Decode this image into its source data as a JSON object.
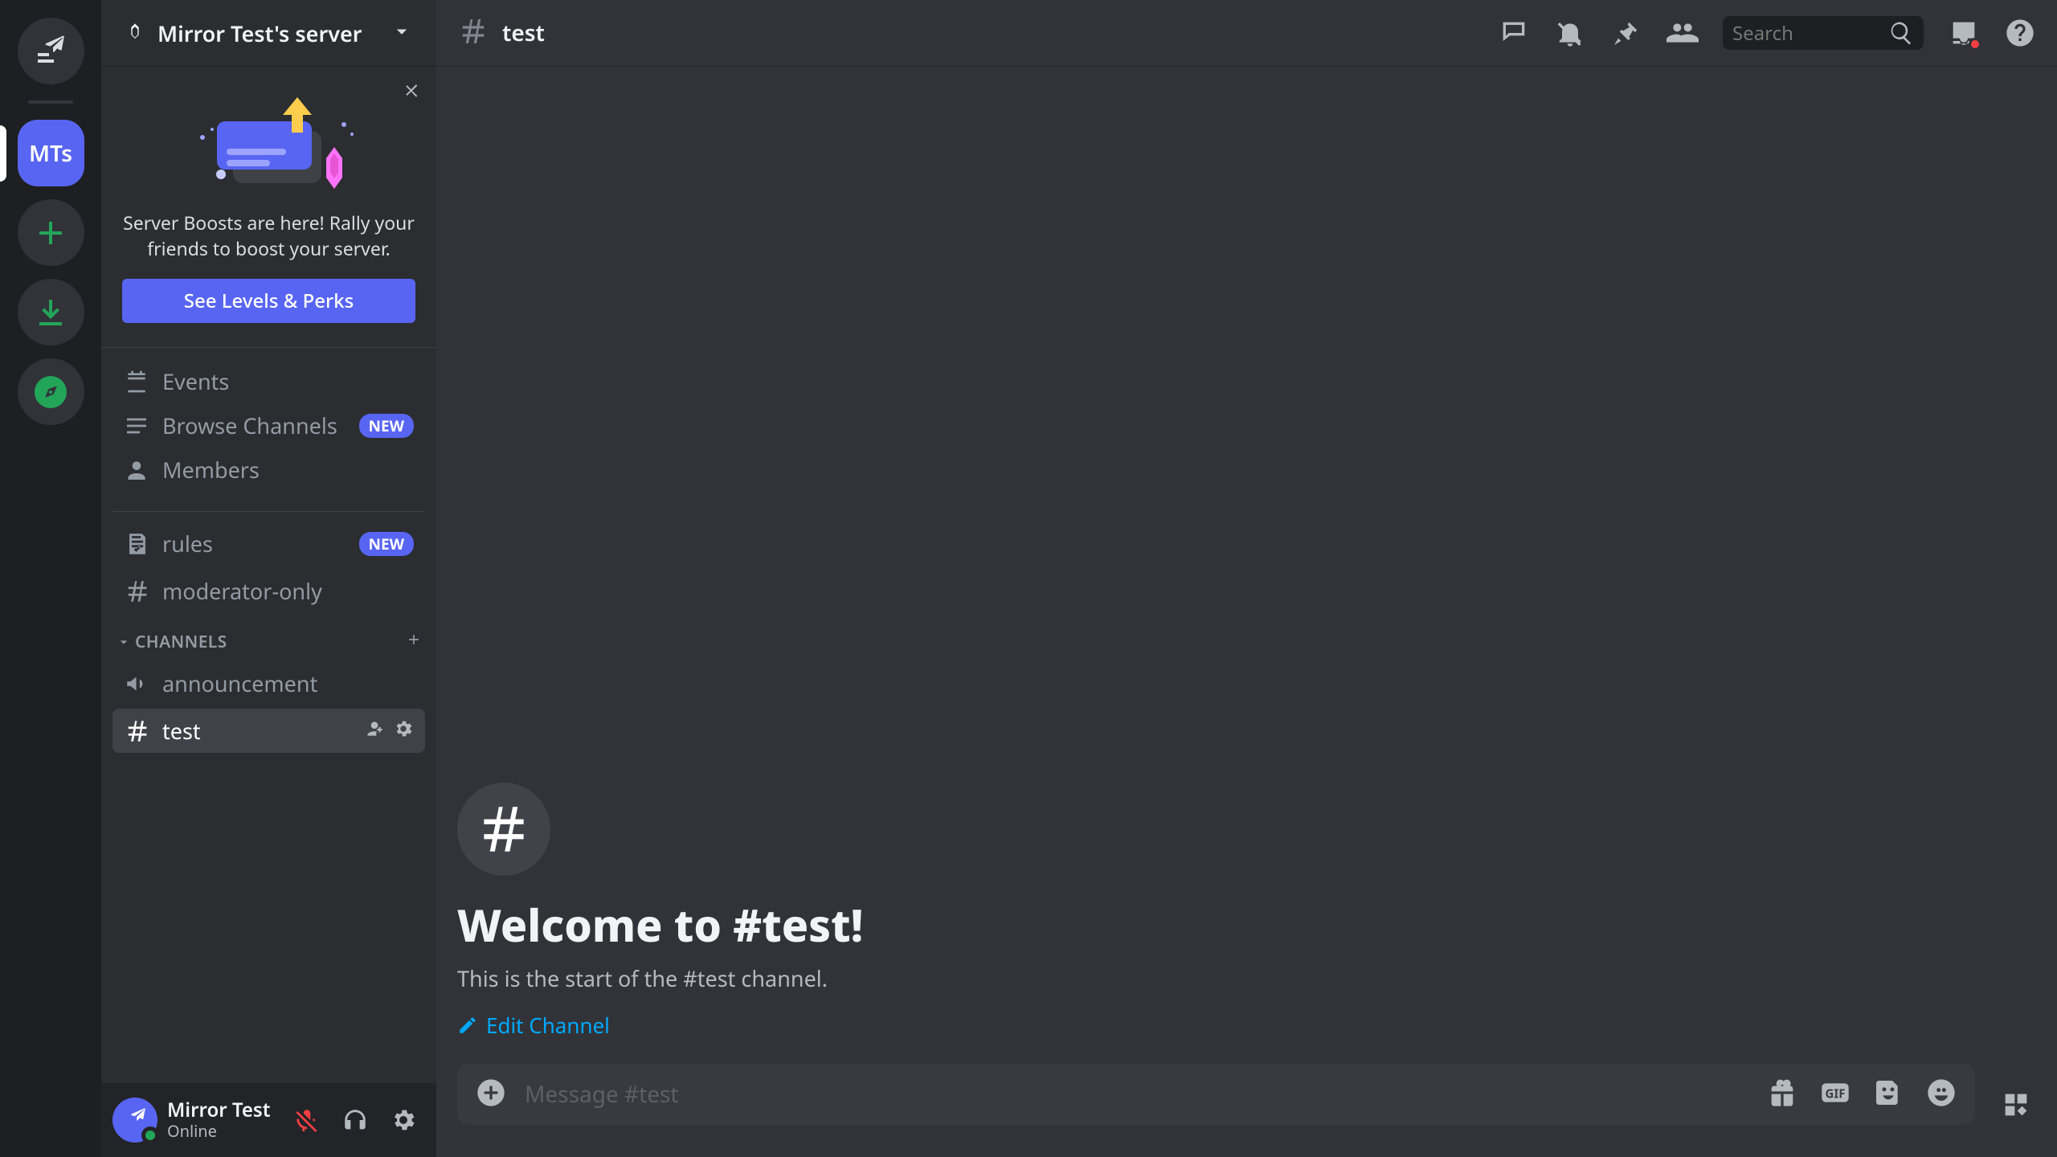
{
  "server": {
    "name": "Mirror Test's server",
    "initials": "MTs"
  },
  "boost": {
    "text": "Server Boosts are here! Rally your friends to boost your server.",
    "button": "See Levels & Perks"
  },
  "sidebar_top": {
    "events": "Events",
    "browse": "Browse Channels",
    "members": "Members",
    "new_badge": "NEW"
  },
  "category": {
    "label": "CHANNELS"
  },
  "channels": {
    "rules": "rules",
    "mod": "moderator-only",
    "announcement": "announcement",
    "test": "test"
  },
  "user": {
    "name": "Mirror Test",
    "status": "Online"
  },
  "header": {
    "channel": "test",
    "search_placeholder": "Search"
  },
  "welcome": {
    "title": "Welcome to #test!",
    "subtitle": "This is the start of the #test channel.",
    "edit": "Edit Channel"
  },
  "composer": {
    "placeholder": "Message #test"
  },
  "colors": {
    "blurple": "#5865f2",
    "green": "#23a559",
    "red": "#f23f43",
    "link": "#00a8fc"
  }
}
